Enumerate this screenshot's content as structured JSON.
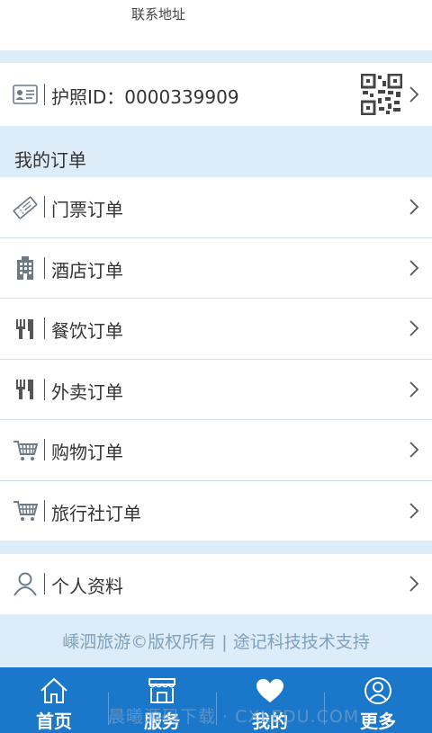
{
  "top": {
    "label": "联系地址"
  },
  "passport": {
    "label": "护照ID：0000339909"
  },
  "orders_title": "我的订单",
  "orders": [
    {
      "label": "门票订单",
      "icon": "ticket-icon"
    },
    {
      "label": "酒店订单",
      "icon": "hotel-icon"
    },
    {
      "label": "餐饮订单",
      "icon": "fork-knife-icon"
    },
    {
      "label": "外卖订单",
      "icon": "fork-knife-icon"
    },
    {
      "label": "购物订单",
      "icon": "cart-icon"
    },
    {
      "label": "旅行社订单",
      "icon": "cart-icon"
    }
  ],
  "profile": {
    "label": "个人资料"
  },
  "footer": {
    "text": "嵊泗旅游©版权所有 | 途记科技技术支持"
  },
  "tabs": [
    {
      "label": "首页",
      "icon": "home-icon"
    },
    {
      "label": "服务",
      "icon": "store-icon"
    },
    {
      "label": "我的",
      "icon": "heart-icon"
    },
    {
      "label": "更多",
      "icon": "user-circle-icon"
    }
  ],
  "watermark": "晨曦源码下载 · CXLEDU.COM",
  "colors": {
    "accent": "#1a77c9",
    "section_bg": "#dcecf8",
    "footer_text": "#7fa1bd"
  }
}
